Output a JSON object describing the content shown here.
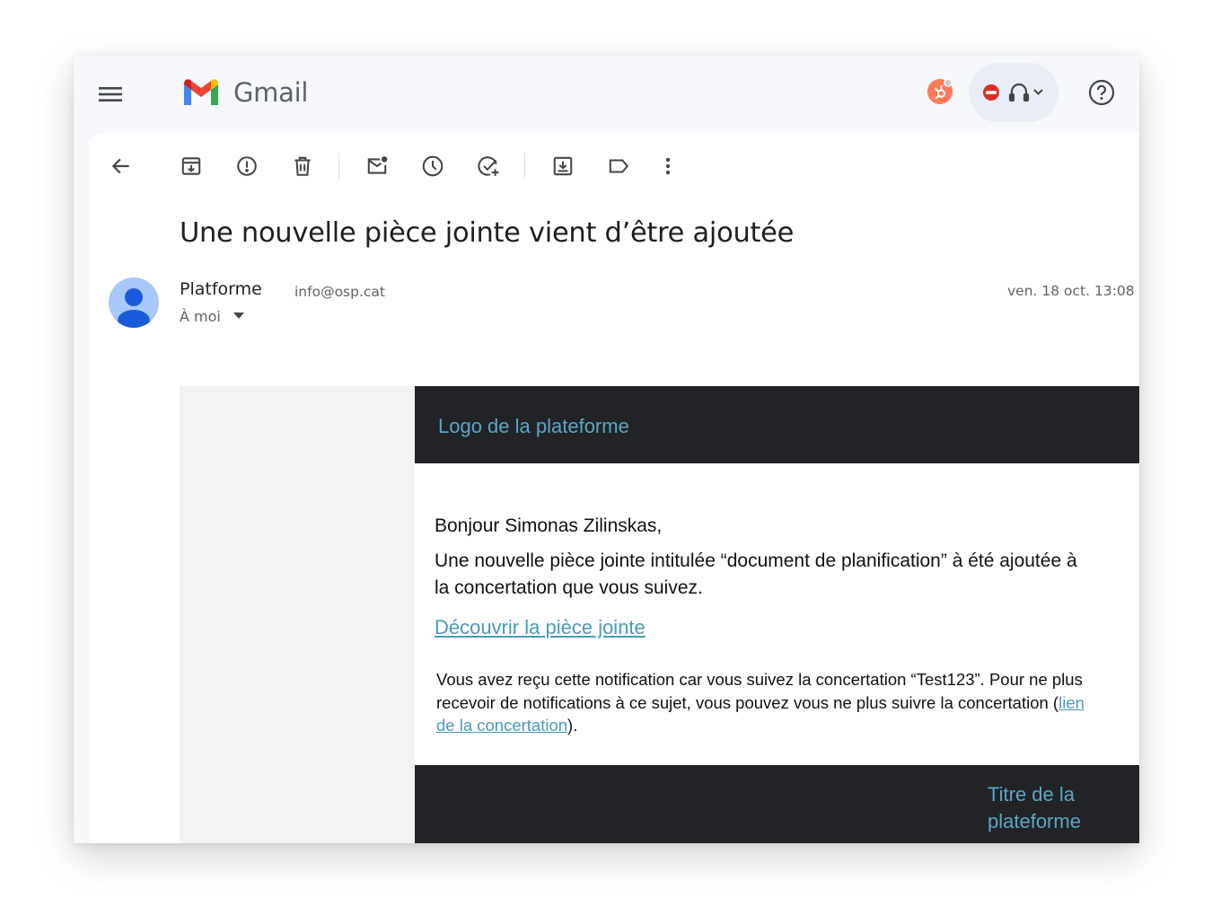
{
  "app": {
    "brand": "Gmail",
    "colors": {
      "accent": "#0b57d0",
      "link": "#4a9ab8",
      "dark": "#222327",
      "hubspot": "#ff7a59",
      "dnd": "#d93025"
    }
  },
  "topbar": {
    "icons": [
      "menu-icon",
      "gmail-logo",
      "hubspot-icon",
      "do-not-disturb-icon",
      "headset-icon",
      "chevron-down-icon",
      "help-icon"
    ]
  },
  "toolbar": {
    "icons": [
      "back-arrow-icon",
      "archive-icon",
      "report-spam-icon",
      "delete-icon",
      "mark-unread-icon",
      "snooze-icon",
      "add-task-icon",
      "move-to-icon",
      "label-icon",
      "more-vert-icon"
    ]
  },
  "message": {
    "subject": "Une nouvelle pièce jointe vient d’être ajoutée",
    "sender_name": "Platforme",
    "sender_email": "info@osp.cat",
    "recipient": "À moi",
    "date": "ven. 18 oct. 13:08 ("
  },
  "email": {
    "header_logo": "Logo de la plateforme",
    "greeting": "Bonjour Simonas Zilinskas,",
    "body": "Une nouvelle pièce jointe intitulée “document de planification” à été ajoutée à la concertation que vous suivez.",
    "cta": "Découvrir la pièce jointe",
    "notice_before": "Vous avez reçu cette notification car vous suivez la concertation “Test123”. Pour ne plus recevoir de notifications à ce sujet, vous pouvez vous ne plus suivre la concertation (",
    "notice_link": "lien de la concertation",
    "notice_after": ").",
    "footer_title": "Titre de la plateforme"
  }
}
